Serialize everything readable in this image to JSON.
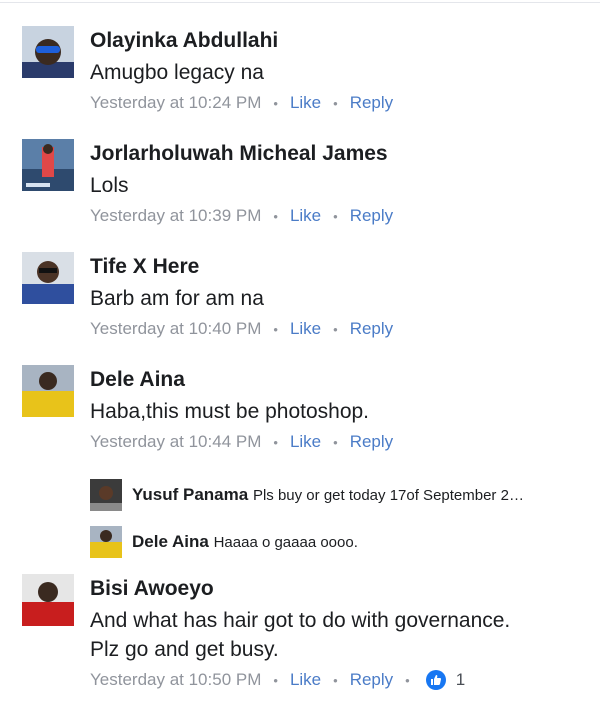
{
  "comments": [
    {
      "name": "Olayinka Abdullahi",
      "text": "Amugbo legacy na",
      "time": "Yesterday at 10:24 PM",
      "like": "Like",
      "reply": "Reply"
    },
    {
      "name": "Jorlarholuwah Micheal James",
      "text": "Lols",
      "time": "Yesterday at 10:39 PM",
      "like": "Like",
      "reply": "Reply"
    },
    {
      "name": "Tife X Here",
      "text": "Barb am for am na",
      "time": "Yesterday at 10:40 PM",
      "like": "Like",
      "reply": "Reply"
    },
    {
      "name": "Dele Aina",
      "text": "Haba,this must be photoshop.",
      "time": "Yesterday at 10:44 PM",
      "like": "Like",
      "reply": "Reply",
      "replies": [
        {
          "name": "Yusuf Panama",
          "text": "Pls buy or get today 17of September 2…"
        },
        {
          "name": "Dele Aina",
          "text": "Haaaa o gaaaa oooo."
        }
      ]
    },
    {
      "name": "Bisi Awoeyo",
      "text_line1": "And what has hair got to do with governance.",
      "text_line2": "Plz go and get busy.",
      "time": "Yesterday at 10:50 PM",
      "like": "Like",
      "reply": "Reply",
      "reaction_icon": "thumbs-up-icon",
      "reaction_count": "1"
    }
  ],
  "colors": {
    "link": "#4b7cc7",
    "meta": "#90949c",
    "like_badge": "#1877f2"
  }
}
